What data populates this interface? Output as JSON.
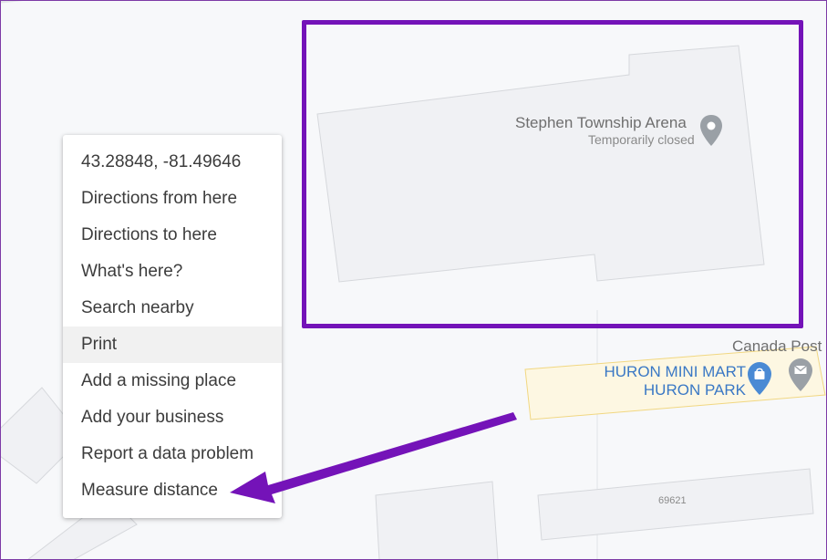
{
  "map": {
    "arena": {
      "name": "Stephen Township Arena",
      "status": "Temporarily closed",
      "icon": "place-pin-icon"
    },
    "canada_post": {
      "name": "Canada Post",
      "icon": "mail-pin-icon"
    },
    "mini_mart": {
      "line1": "HURON MINI MART",
      "line2": "HURON PARK",
      "icon": "shopping-bag-pin-icon"
    },
    "address_label": "69621"
  },
  "context_menu": {
    "coordinates": "43.28848, -81.49646",
    "items": [
      "Directions from here",
      "Directions to here",
      "What's here?",
      "Search nearby",
      "Print",
      "Add a missing place",
      "Add your business",
      "Report a data problem",
      "Measure distance"
    ]
  },
  "annotation": {
    "color": "#7413b8"
  }
}
